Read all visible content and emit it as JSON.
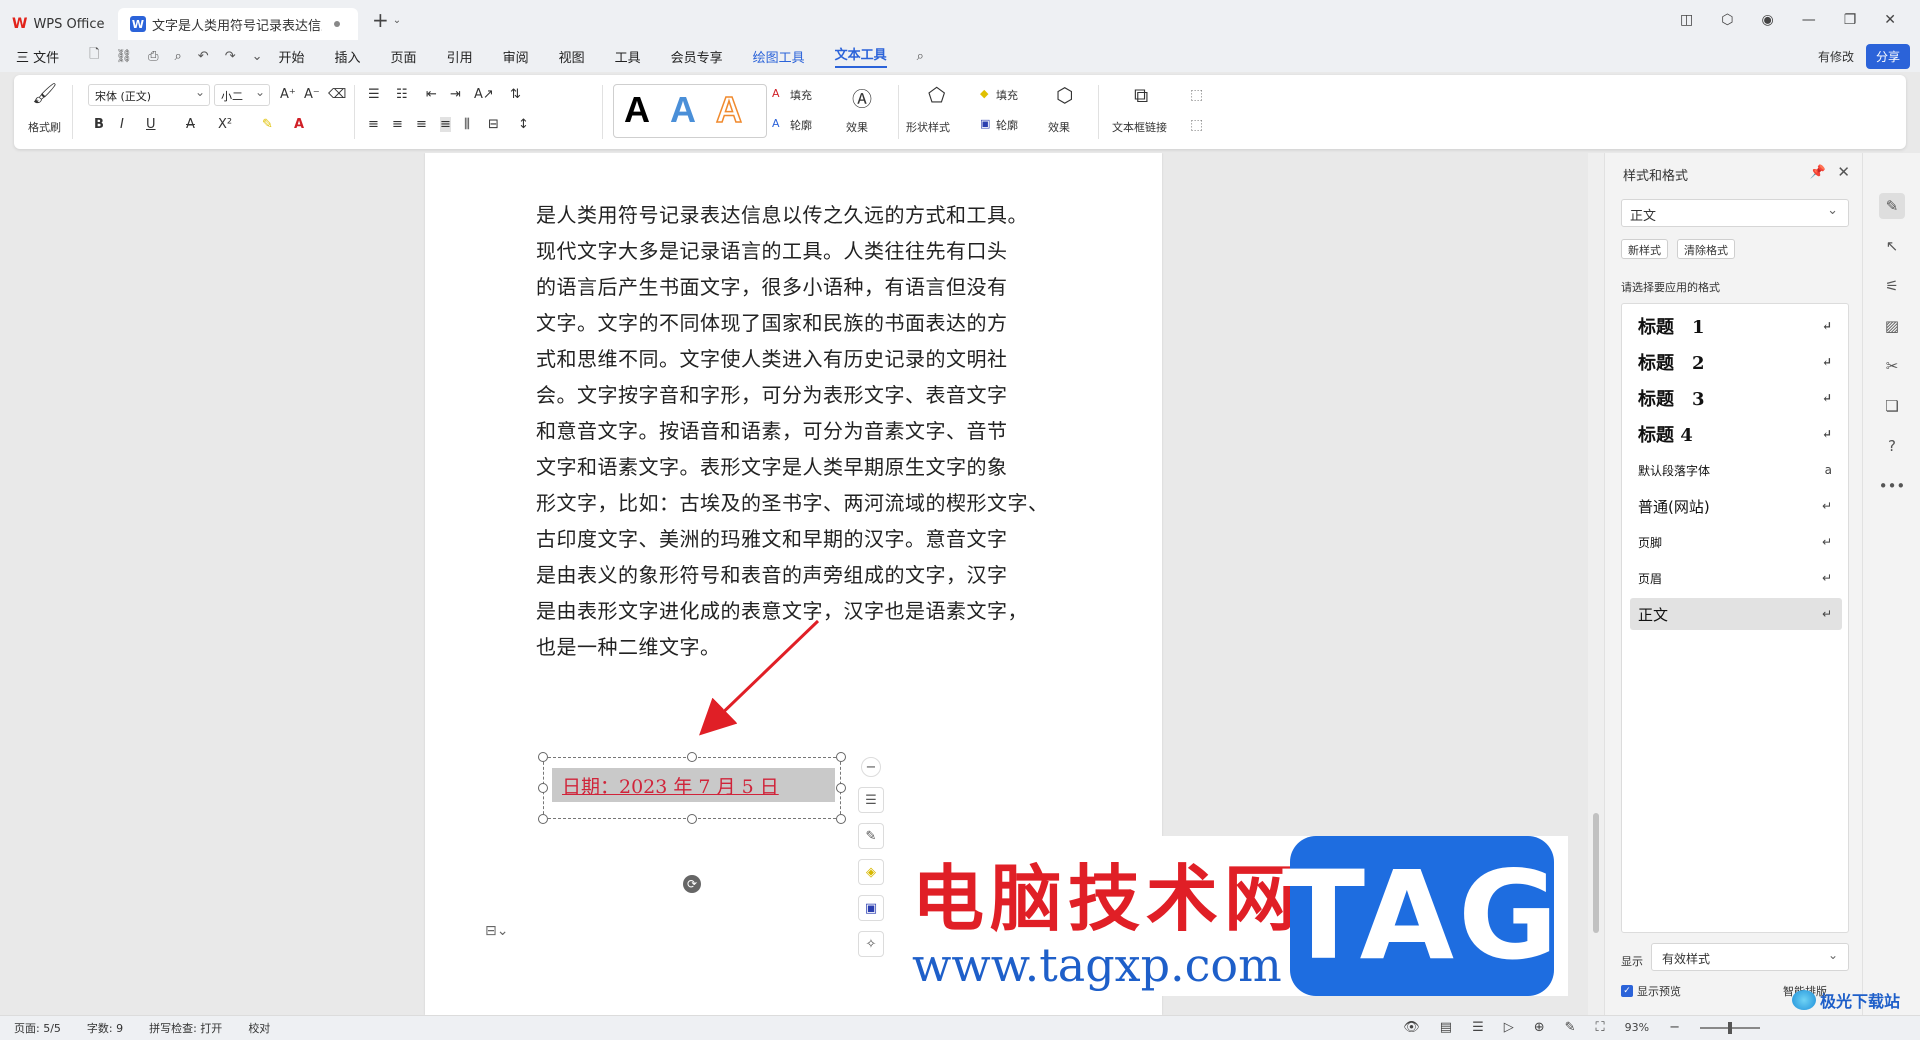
{
  "titlebar": {
    "app_tab": "WPS Office",
    "doc_tab": "文字是人类用符号记录表达信息以传之久远的方式和工具",
    "doc_icon": "W",
    "new_tab": "+",
    "window_icons": [
      "layout-icon",
      "cube-icon",
      "avatar-icon",
      "minimize-icon",
      "restore-icon",
      "close-icon"
    ]
  },
  "menubar": {
    "file": "三 文件",
    "items": [
      "开始",
      "插入",
      "页面",
      "引用",
      "审阅",
      "视图",
      "工具",
      "会员专享"
    ],
    "drawing_tools": "绘图工具",
    "text_tools": "文本工具",
    "has_changes": "有修改",
    "share": "分享"
  },
  "ribbon": {
    "format_painter": "格式刷",
    "font_name": "宋体 (正文)",
    "font_size": "小二",
    "fill": "填充",
    "outline": "轮廓",
    "effects": "效果",
    "shape_styles": "形状样式",
    "shape_fill": "填充",
    "shape_outline": "轮廓",
    "shape_effects": "效果",
    "textbox_link": "文本框链接",
    "art_letter": "A"
  },
  "document": {
    "lines": [
      "是人类用符号记录表达信息以传之久远的方式和工具。",
      "现代文字大多是记录语言的工具。人类往往先有口头",
      "的语言后产生书面文字，很多小语种，有语言但没有",
      "文字。文字的不同体现了国家和民族的书面表达的方",
      "式和思维不同。文字使人类进入有历史记录的文明社",
      "会。文字按字音和字形，可分为表形文字、表音文字",
      "和意音文字。按语音和语素，可分为音素文字、音节",
      "文字和语素文字。表形文字是人类早期原生文字的象",
      "形文字，比如：古埃及的圣书字、两河流域的楔形文字、",
      "古印度文字、美洲的玛雅文和早期的汉字。意音文字",
      "是由表义的象形符号和表音的声旁组成的文字，汉字",
      "是由表形文字进化成的表意文字，汉字也是语素文字，",
      "也是一种二维文字。"
    ],
    "textbox_text": "日期：2023 年 7 月 5 日"
  },
  "watermark": {
    "chinese": "电脑技术网",
    "url": "www.tagxp.com",
    "tag": "TAG",
    "site": "极光下载站"
  },
  "panel": {
    "title": "样式和格式",
    "current_style": "正文",
    "new_style": "新样式",
    "clear_format": "清除格式",
    "hint": "请选择要应用的格式",
    "styles": [
      {
        "label": "标题　1",
        "kind": "h"
      },
      {
        "label": "标题　2",
        "kind": "h"
      },
      {
        "label": "标题　3",
        "kind": "h"
      },
      {
        "label": "标题 4",
        "kind": "h"
      },
      {
        "label": "默认段落字体",
        "kind": "small"
      },
      {
        "label": "普通(网站)",
        "kind": "mid"
      },
      {
        "label": "页脚",
        "kind": "small"
      },
      {
        "label": "页眉",
        "kind": "small"
      },
      {
        "label": "正文",
        "kind": "mid"
      }
    ],
    "return_mark": "↵",
    "char_mark": "a",
    "show_label": "显示",
    "show_value": "有效样式",
    "preview": "显示预览",
    "smart_layout": "智能排版"
  },
  "status": {
    "page": "页面: 5/5",
    "words": "字数: 9",
    "spell": "拼写检查: 打开",
    "proof": "校对",
    "zoom": "93%"
  }
}
